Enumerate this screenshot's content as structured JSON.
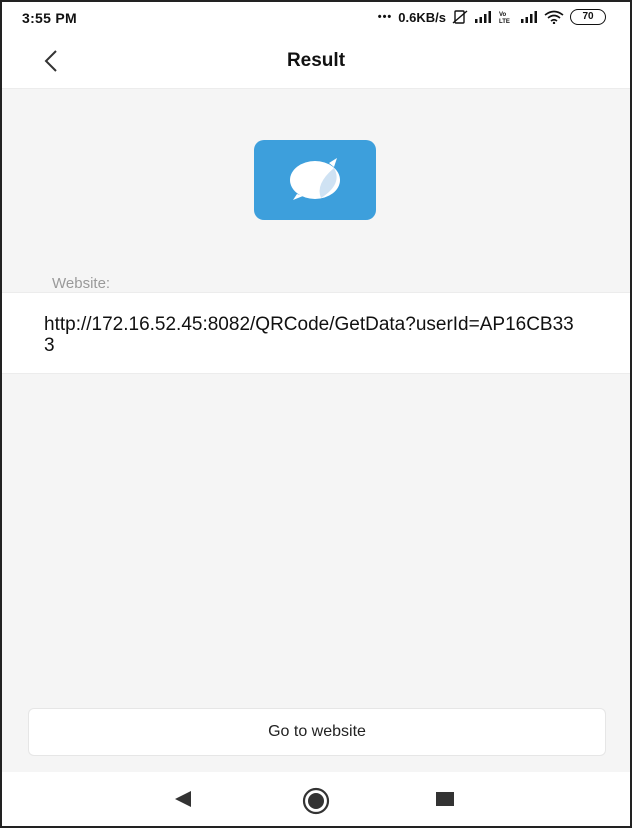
{
  "status_bar": {
    "time": "3:55 PM",
    "dots": "•••",
    "network_speed": "0.6KB/s",
    "battery": "70",
    "icons": [
      "no-sim-icon",
      "signal-icon",
      "volte-icon",
      "signal-icon",
      "wifi-icon",
      "battery-icon"
    ]
  },
  "header": {
    "title": "Result",
    "back_icon": "chevron-left-icon"
  },
  "result": {
    "app_icon": "browser-app-icon",
    "accent_color": "#3d9fdc",
    "label": "Website:",
    "url": "http://172.16.52.45:8082/QRCode/GetData?userId=AP16CB333"
  },
  "actions": {
    "go_to_website": "Go to website"
  },
  "nav_bar": {
    "icons": [
      "back-triangle-icon",
      "home-circle-icon",
      "recents-square-icon"
    ]
  }
}
